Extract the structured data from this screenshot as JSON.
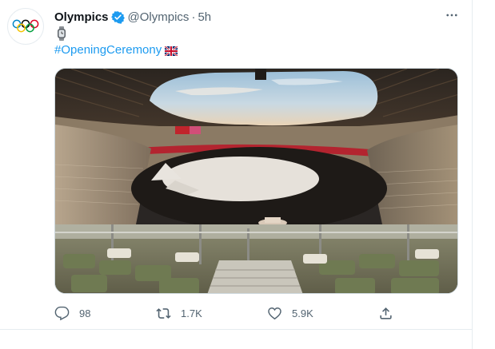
{
  "tweet": {
    "author_name": "Olympics",
    "author_handle": "@Olympics",
    "separator": "·",
    "timestamp": "5h",
    "hashtag": "#OpeningCeremony",
    "emoji": "watch-emoji",
    "hashtag_emoji": "flag-emoji"
  },
  "icons": {
    "avatar": "olympic-rings-logo",
    "verified": "verified-badge-icon",
    "more": "more-options-icon",
    "reply": "reply-icon",
    "retweet": "retweet-icon",
    "like": "heart-icon",
    "share": "share-icon"
  },
  "stats": {
    "replies": "98",
    "retweets": "1.7K",
    "likes": "5.9K"
  },
  "colors": {
    "link": "#1d9bf0",
    "verified": "#1d9bf0",
    "secondary_text": "#536471",
    "text": "#0f1419"
  },
  "media": {
    "type": "photo",
    "subject": "olympic-stadium-interior"
  }
}
